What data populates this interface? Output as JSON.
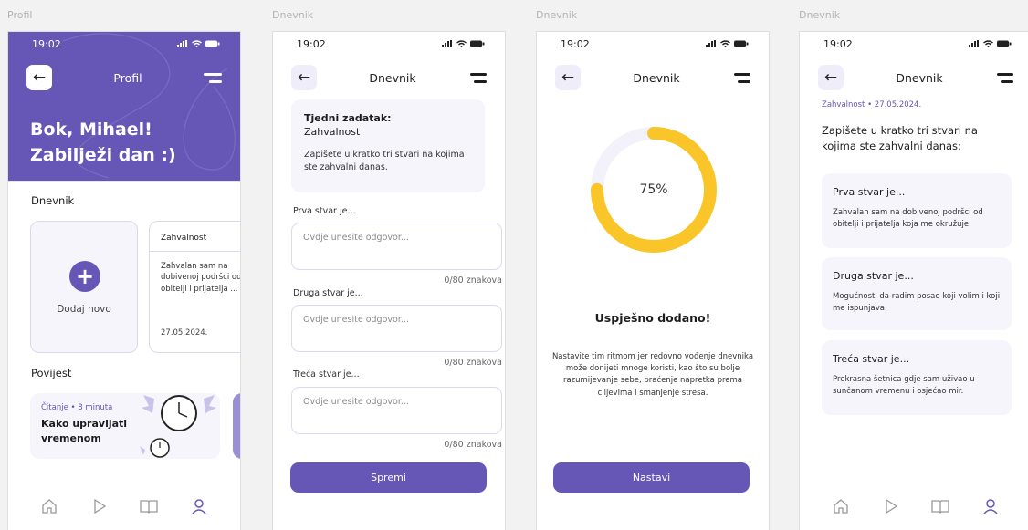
{
  "artboards": [
    "Profil",
    "Dnevnik",
    "Dnevnik",
    "Dnevnik"
  ],
  "status": {
    "time": "19:02"
  },
  "colors": {
    "accent": "#6656b6",
    "progress": "#fac529",
    "progress_track": "#f3f2fa",
    "card_bg": "#f6f5fc"
  },
  "icons": {
    "nav": [
      "home-icon",
      "play-icon",
      "book-icon",
      "profile-icon"
    ]
  },
  "profile": {
    "title": "Profil",
    "greeting_line1": "Bok, Mihael!",
    "greeting_line2": "Zabilježi dan :)",
    "journal_section": "Dnevnik",
    "add_new": "Dodaj novo",
    "entry": {
      "title": "Zahvalnost",
      "text": "Zahvalan sam na dobivenoj podršci od obitelji i prijatelja ...",
      "date": "27.05.2024."
    },
    "history_section": "Povijest",
    "history_card": {
      "meta": "Čitanje • 8 minuta",
      "title_line1": "Kako upravljati",
      "title_line2": "vremenom"
    }
  },
  "journal_form": {
    "title": "Dnevnik",
    "task_label": "Tjedni zadatak:",
    "task_name": "Zahvalnost",
    "task_desc": "Zapišete u kratko tri stvari na kojima ste zahvalni danas.",
    "fields": [
      {
        "label": "Prva stvar je...",
        "placeholder": "Ovdje unesite odgovor...",
        "counter": "0/80 znakova"
      },
      {
        "label": "Druga stvar je...",
        "placeholder": "Ovdje unesite odgovor...",
        "counter": "0/80 znakova"
      },
      {
        "label": "Treća stvar je...",
        "placeholder": "Ovdje unesite odgovor...",
        "counter": "0/80 znakova"
      }
    ],
    "save_label": "Spremi"
  },
  "success": {
    "title": "Dnevnik",
    "progress_value": 75,
    "progress_label": "75%",
    "heading": "Uspješno dodano!",
    "message": "Nastavite tim ritmom jer redovno vođenje dnevnika može donijeti mnoge koristi, kao što su bolje razumijevanje sebe, praćenje napretka prema ciljevima i smanjenje stresa.",
    "continue_label": "Nastavi"
  },
  "entry_view": {
    "title": "Dnevnik",
    "meta": "Zahvalnost • 27.05.2024.",
    "prompt": "Zapišete u kratko tri stvari na kojima ste zahvalni danas:",
    "answers": [
      {
        "label": "Prva stvar je...",
        "text": "Zahvalan sam na dobivenoj podršci od obitelji i prijatelja koja me okružuje."
      },
      {
        "label": "Druga stvar je...",
        "text": "Mogućnosti da radim posao koji volim i koji me ispunjava."
      },
      {
        "label": "Treća stvar je...",
        "text": "Prekrasna šetnica gdje sam uživao u sunčanom vremenu i osjećao mir."
      }
    ]
  }
}
